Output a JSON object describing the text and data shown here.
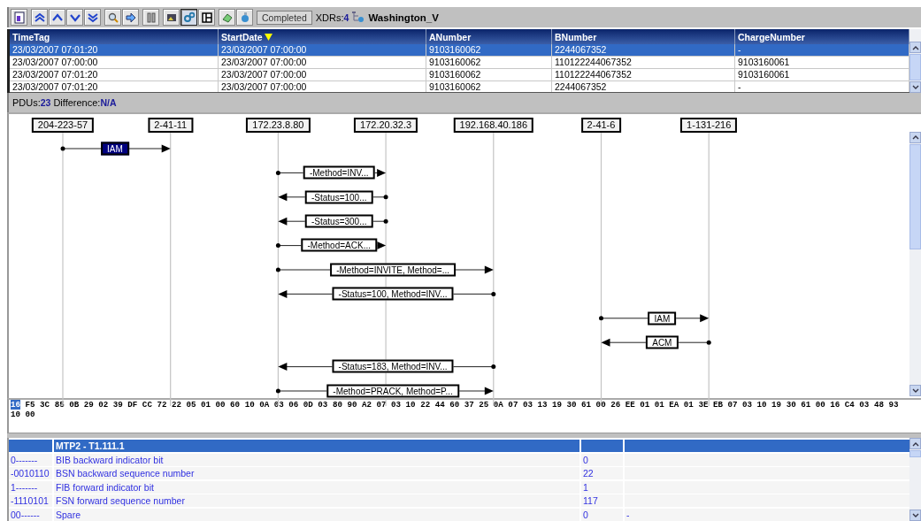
{
  "toolbar": {
    "groups": [
      [
        {
          "pressed": false
        }
      ],
      [
        {
          "pressed": false
        },
        {
          "pressed": false
        },
        {
          "pressed": false
        },
        {
          "pressed": false
        }
      ],
      [
        {
          "pressed": false
        },
        {
          "pressed": false
        }
      ],
      [
        {
          "pressed": false
        }
      ],
      [
        {
          "pressed": false
        },
        {
          "pressed": true
        },
        {
          "pressed": false
        }
      ],
      [
        {
          "pressed": false
        },
        {
          "pressed": false
        }
      ]
    ],
    "status": "Completed",
    "xdrs_label": "XDRs:",
    "xdrs_count": "4",
    "source": "Washington_V"
  },
  "table": {
    "columns": [
      {
        "label": "TimeTag",
        "sorted": false
      },
      {
        "label": "StartDate",
        "sorted": true
      },
      {
        "label": "ANumber",
        "sorted": false
      },
      {
        "label": "BNumber",
        "sorted": false
      },
      {
        "label": "ChargeNumber",
        "sorted": false
      }
    ],
    "rows": [
      {
        "selected": true,
        "cells": [
          "23/03/2007 07:01:20",
          "23/03/2007 07:00:00",
          "9103160062",
          "2244067352",
          "-"
        ]
      },
      {
        "selected": false,
        "cells": [
          "23/03/2007 07:00:00",
          "23/03/2007 07:00:00",
          "9103160062",
          "110122244067352",
          "9103160061"
        ]
      },
      {
        "selected": false,
        "cells": [
          "23/03/2007 07:01:20",
          "23/03/2007 07:00:00",
          "9103160062",
          "110122244067352",
          "9103160061"
        ]
      },
      {
        "selected": false,
        "cells": [
          "23/03/2007 07:01:20",
          "23/03/2007 07:00:00",
          "9103160062",
          "2244067352",
          "-"
        ]
      }
    ]
  },
  "summary": {
    "pdus_label": "PDUs:",
    "pdus": "23",
    "difference_label": "Difference:",
    "difference": "N/A"
  },
  "diagram": {
    "lifelines": [
      "204-223-57",
      "2-41-11",
      "172.23.8.80",
      "172.20.32.3",
      "192.168.40.186",
      "2-41-6",
      "1-131-216"
    ],
    "messages": [
      {
        "label": "IAM",
        "selected": true
      },
      {
        "label": "-Method=INV...",
        "selected": false
      },
      {
        "label": "-Status=100...",
        "selected": false
      },
      {
        "label": "-Status=300...",
        "selected": false
      },
      {
        "label": "-Method=ACK...",
        "selected": false
      },
      {
        "label": "-Method=INVITE, Method=...",
        "selected": false
      },
      {
        "label": "-Status=100, Method=INV...",
        "selected": false
      },
      {
        "label": "IAM",
        "selected": false
      },
      {
        "label": "ACM",
        "selected": false
      },
      {
        "label": "-Status=183, Method=INV...",
        "selected": false
      },
      {
        "label": "-Method=PRACK, Method=P...",
        "selected": false
      }
    ]
  },
  "hex": {
    "lines": [
      [
        {
          "text": "16",
          "selected": true
        },
        {
          "text": "F5 3C 85 0B 29 02 39 DF CC 72 22 05 01 00 60 10 0A 03 06 0D 03 80 90 A2 07 03 10 22 44 60 37 25 0A 07 03 13 19 30 61 00 26 EE 01 01 EA 01 3E EB 07 03 10 19 30 61 00 16 C4 03 48 93",
          "selected": false
        }
      ],
      [
        {
          "text": "10 00",
          "selected": false
        }
      ]
    ]
  },
  "decode": {
    "header": "MTP2 - T1.111.1",
    "rows": [
      [
        "0-------",
        "BIB backward indicator bit",
        "0",
        ""
      ],
      [
        "-0010110",
        "BSN backward sequence number",
        "22",
        ""
      ],
      [
        "1-------",
        "FIB forward indicator bit",
        "1",
        ""
      ],
      [
        "-1110101",
        "FSN forward sequence number",
        "117",
        ""
      ],
      [
        "00------",
        "Spare",
        "0",
        "-"
      ]
    ]
  }
}
